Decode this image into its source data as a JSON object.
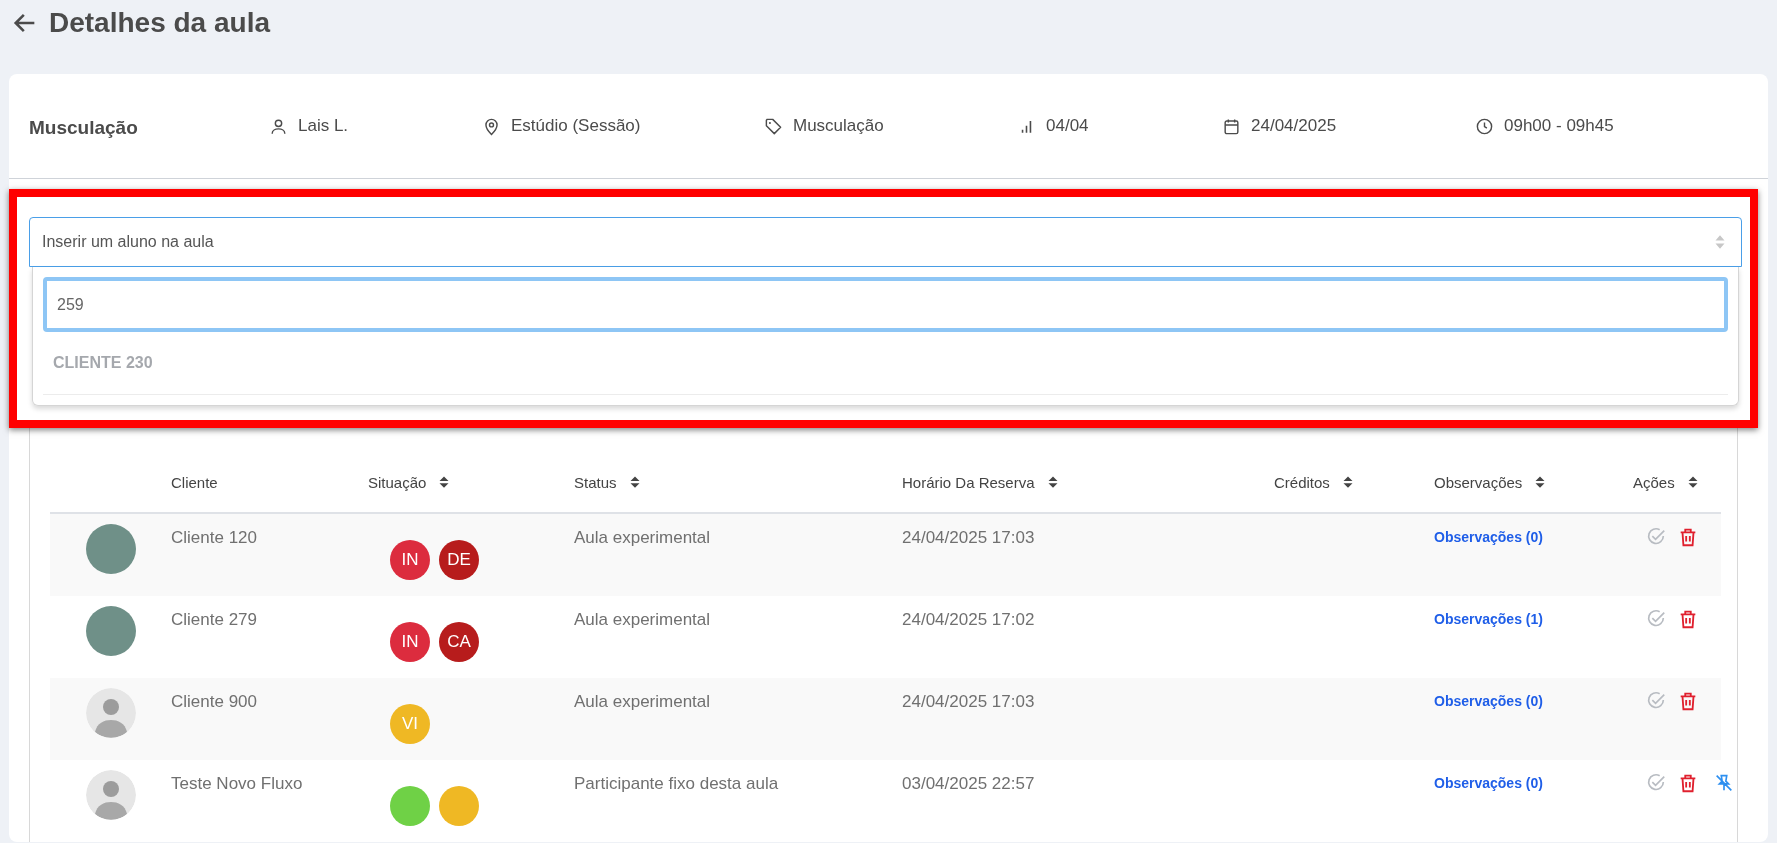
{
  "page": {
    "title": "Detalhes da aula"
  },
  "class_info": {
    "name": "Musculação",
    "details": [
      {
        "kind": "person",
        "text": "Lais L."
      },
      {
        "kind": "location",
        "text": "Estúdio (Sessão)"
      },
      {
        "kind": "tag",
        "text": "Musculação"
      },
      {
        "kind": "level",
        "text": "04/04"
      },
      {
        "kind": "date",
        "text": "24/04/2025"
      },
      {
        "kind": "time",
        "text": "09h00 - 09h45"
      }
    ]
  },
  "student_select": {
    "placeholder": "Inserir um aluno na aula",
    "expanded": true,
    "search_value": "259",
    "options": [
      {
        "label": "CLIENTE 230",
        "disabled": true
      }
    ]
  },
  "table": {
    "columns": [
      {
        "label": "Cliente",
        "sortable": false
      },
      {
        "label": "Situação",
        "sortable": true
      },
      {
        "label": "Status",
        "sortable": true
      },
      {
        "label": "Horário Da Reserva",
        "sortable": true
      },
      {
        "label": "Créditos",
        "sortable": true
      },
      {
        "label": "Observações",
        "sortable": true
      },
      {
        "label": "Ações",
        "sortable": true
      }
    ],
    "rows": [
      {
        "avatar": {
          "kind": "portrait"
        },
        "client": "Cliente 120",
        "badges": [
          {
            "label": "IN",
            "color": "#dc2c3e"
          },
          {
            "label": "DE",
            "color": "#b71c1c"
          }
        ],
        "status": "Aula experimental",
        "reserved_at": "24/04/2025 17:03",
        "notes": "Observações (0)",
        "actions": [
          {
            "kind": "confirm"
          },
          {
            "kind": "delete"
          }
        ]
      },
      {
        "avatar": {
          "kind": "portrait"
        },
        "client": "Cliente 279",
        "badges": [
          {
            "label": "IN",
            "color": "#dc2c3e"
          },
          {
            "label": "CA",
            "color": "#b71c1c"
          }
        ],
        "status": "Aula experimental",
        "reserved_at": "24/04/2025 17:02",
        "notes": "Observações (1)",
        "actions": [
          {
            "kind": "confirm"
          },
          {
            "kind": "delete"
          }
        ]
      },
      {
        "avatar": {
          "kind": "default"
        },
        "client": "Cliente 900",
        "badges": [
          {
            "label": "VI",
            "color": "#efb824"
          }
        ],
        "status": "Aula experimental",
        "reserved_at": "24/04/2025 17:03",
        "notes": "Observações (0)",
        "actions": [
          {
            "kind": "confirm"
          },
          {
            "kind": "delete"
          }
        ]
      },
      {
        "avatar": {
          "kind": "default"
        },
        "client": "Teste Novo Fluxo",
        "badges": [
          {
            "color": "#6fd146"
          },
          {
            "color": "#efb824"
          }
        ],
        "status": "Participante fixo desta aula",
        "reserved_at": "03/04/2025 22:57",
        "notes": "Observações (0)",
        "actions": [
          {
            "kind": "confirm"
          },
          {
            "kind": "delete"
          },
          {
            "kind": "unpin"
          }
        ]
      }
    ]
  }
}
